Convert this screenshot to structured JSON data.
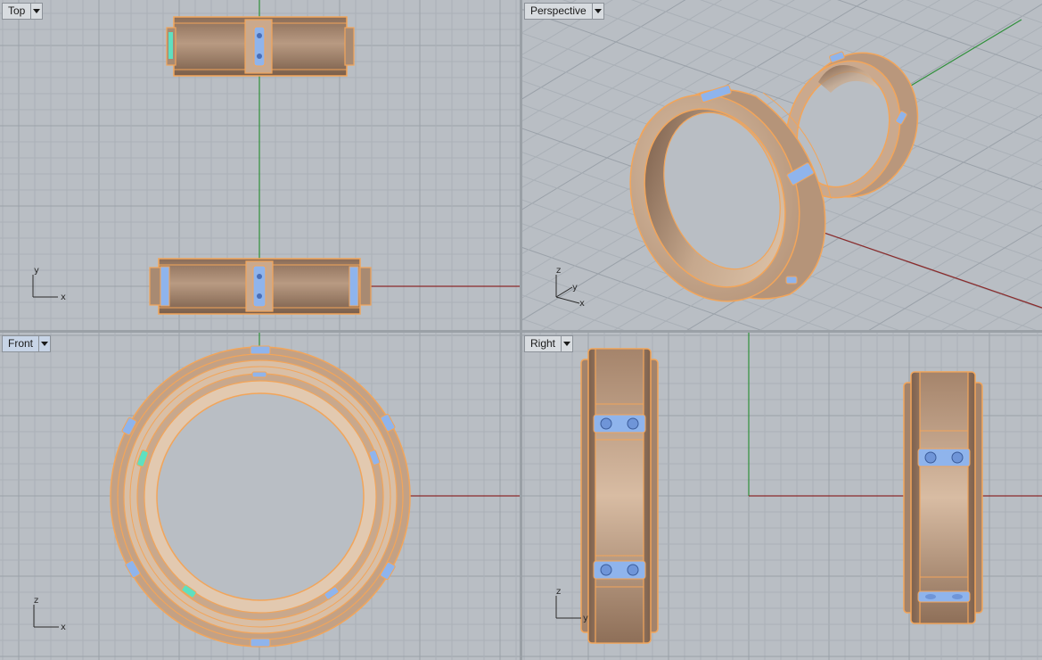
{
  "viewports": {
    "top": {
      "label": "Top",
      "active": false,
      "axes": [
        "y",
        "x"
      ]
    },
    "perspective": {
      "label": "Perspective",
      "active": false,
      "axes": [
        "z",
        "y",
        "x"
      ]
    },
    "front": {
      "label": "Front",
      "active": true,
      "axes": [
        "z",
        "x"
      ]
    },
    "right": {
      "label": "Right",
      "active": false,
      "axes": [
        "z",
        "y"
      ]
    }
  },
  "colors": {
    "viewport_bg": "#b9bec4",
    "grid_minor": "#aab0b7",
    "grid_major": "#9aa1a9",
    "x_axis": "#8b2a2a",
    "y_axis": "#2f8f3a",
    "ring_metal": "#c9a98c",
    "ring_edge": "#f2a55a",
    "stone_setting": "#8fb4ec",
    "selected_setting": "#5ee0c0"
  },
  "icons": {
    "viewport_menu": "chevron-down-icon"
  }
}
